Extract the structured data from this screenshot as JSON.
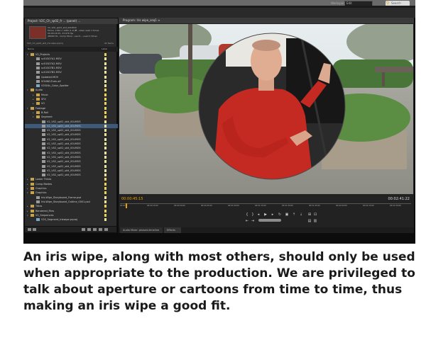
{
  "app": {
    "workspace_label": "Workspace:",
    "workspace_value": "Edit",
    "search_placeholder": "Search"
  },
  "project_panel": {
    "tab_label": "Project: V2C_Ch_sp02_fr ... (panel) ... ",
    "clip_name": "V2_V02_sp02_skit_00LMOS",
    "clip_lines": [
      "Movie, 1920 x 1080 (1.0)  ▼ , video used 1 times",
      "00:00:18:15, 23.976 fps",
      "48000 Hz - Comp Mono  --sec:0 -- used 1 times"
    ],
    "bin_path": "V2C_Ch_sp02_skit_Iris wipe.prproj",
    "items_count": "41 Items",
    "columns": [
      "Name",
      "Label"
    ],
    "tree": [
      {
        "label": "V2_Projects",
        "level": 0,
        "type": "bin",
        "expanded": true
      },
      {
        "label": "sc01S07A1.MOV",
        "level": 1,
        "type": "clip"
      },
      {
        "label": "sc01S07A2.MOV",
        "level": 1,
        "type": "clip"
      },
      {
        "label": "sc01S07B1.MOV",
        "level": 1,
        "type": "clip"
      },
      {
        "label": "sc01S07B2.MOV",
        "level": 1,
        "type": "clip"
      },
      {
        "label": "Updated.MOV",
        "level": 1,
        "type": "clip"
      },
      {
        "label": "SOUND-Train.aif",
        "level": 1,
        "type": "clip"
      },
      {
        "label": "V2S04c_Color_Spotter",
        "level": 1,
        "type": "sequence"
      },
      {
        "label": "Audio",
        "level": 0,
        "type": "bin",
        "expanded": true
      },
      {
        "label": "Music",
        "level": 1,
        "type": "bin"
      },
      {
        "label": "SFX",
        "level": 1,
        "type": "bin"
      },
      {
        "label": "VO",
        "level": 1,
        "type": "bin"
      },
      {
        "label": "Footage",
        "level": 0,
        "type": "bin",
        "expanded": true
      },
      {
        "label": "B-Roll",
        "level": 1,
        "type": "bin"
      },
      {
        "label": "Segment",
        "level": 1,
        "type": "bin",
        "expanded": true
      },
      {
        "label": "V2_V02_sp02_skit_00LMOS",
        "level": 2,
        "type": "clip"
      },
      {
        "label": "V2_V02_sp02_skit_00LMOS",
        "level": 2,
        "type": "clip",
        "selected": true
      },
      {
        "label": "V2_V02_sp02_skit_00LMOS",
        "level": 2,
        "type": "clip"
      },
      {
        "label": "V2_V02_sp02_skit_00LMOS",
        "level": 2,
        "type": "clip"
      },
      {
        "label": "V2_V02_sp02_skit_00LMOS",
        "level": 2,
        "type": "clip"
      },
      {
        "label": "V2_V02_sp02_skit_00LMOS",
        "level": 2,
        "type": "clip"
      },
      {
        "label": "V2_V02_sp02_skit_00LMOS",
        "level": 2,
        "type": "clip"
      },
      {
        "label": "V2_V02_sp02_skit_00LMOS",
        "level": 2,
        "type": "clip"
      },
      {
        "label": "V2_V02_sp02_skit_00LMOS",
        "level": 2,
        "type": "clip"
      },
      {
        "label": "V2_V02_sp02_skit_00LMOS",
        "level": 2,
        "type": "clip"
      },
      {
        "label": "V2_V02_sp02_skit_00LMOS",
        "level": 2,
        "type": "clip"
      },
      {
        "label": "V2_V02_sp02_skit_00LMOS",
        "level": 2,
        "type": "clip"
      },
      {
        "label": "V2_V02_sp02_skit_00LMOS",
        "level": 2,
        "type": "clip"
      },
      {
        "label": "Lower Thirds",
        "level": 0,
        "type": "bin"
      },
      {
        "label": "Comp Mattes",
        "level": 0,
        "type": "bin"
      },
      {
        "label": "Graphics",
        "level": 0,
        "type": "bin"
      },
      {
        "label": "Graphics",
        "level": 0,
        "type": "bin",
        "expanded": true
      },
      {
        "label": "Iris-Wipe_Storyboard_Frame.psd",
        "level": 1,
        "type": "clip"
      },
      {
        "label": "Iris-Wipe_Storyboard_Outline_0001.psd",
        "level": 1,
        "type": "clip"
      },
      {
        "label": "Titles",
        "level": 0,
        "type": "bin"
      },
      {
        "label": "Rendered_Files",
        "level": 0,
        "type": "bin"
      },
      {
        "label": "V2_Sequences",
        "level": 0,
        "type": "bin",
        "expanded": true
      },
      {
        "label": "V2S_Segment_Iriswipe.prproj",
        "level": 1,
        "type": "sequence"
      }
    ]
  },
  "program_monitor": {
    "tab_label": "Program: Iris wipe_seq1 ≡",
    "timecode_current": "00:00:45:15",
    "timecode_duration": "00:02:41:22",
    "ruler_ticks": [
      "00:00",
      "00:00:15:00",
      "00:00:30:00",
      "00:00:45:00",
      "00:01:00:00",
      "00:01:15:00",
      "00:01:30:00",
      "00:01:45:00",
      "00:02:00:00",
      "00:02:15:00",
      "00:02:30:00"
    ],
    "playhead_fraction": 0.02,
    "bottom_tabs": [
      "Audio Mixer: phased-timeline",
      "Effects"
    ]
  },
  "caption": {
    "lines": [
      "An iris wipe, along with most others, should only be used",
      "when appropriate to the production. We are privileged to",
      "talk about aperture or cartoons from time to time, thus",
      "making an iris wipe a good fit."
    ]
  },
  "colors": {
    "timecode_accent": "#e8a000",
    "selection": "#3d5a7a",
    "bin_folder": "#c8a24a",
    "label_swatch": "#e8d35a"
  }
}
